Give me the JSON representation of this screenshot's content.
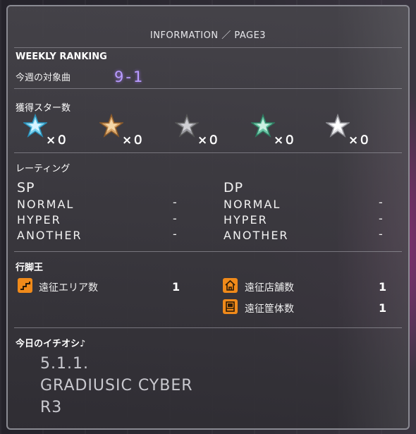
{
  "header": {
    "title": "INFORMATION ／ PAGE3"
  },
  "weekly": {
    "heading": "WEEKLY RANKING",
    "target_label": "今週の対象曲",
    "target_song": "9-1"
  },
  "stars": {
    "heading": "獲得スター数",
    "items": [
      {
        "color": "blue-star",
        "count": "×０"
      },
      {
        "color": "gold-star",
        "count": "×０"
      },
      {
        "color": "silver-star",
        "count": "×０"
      },
      {
        "color": "green-star",
        "count": "×０"
      },
      {
        "color": "white-star",
        "count": "×０"
      }
    ]
  },
  "rating": {
    "heading": "レーティング",
    "sp": {
      "label": "SP",
      "normal": "NORMAL",
      "hyper": "HYPER",
      "another": "ANOTHER",
      "normal_value": "-",
      "hyper_value": "-",
      "another_value": "-"
    },
    "dp": {
      "label": "DP",
      "normal": "NORMAL",
      "hyper": "HYPER",
      "another": "ANOTHER",
      "normal_value": "-",
      "hyper_value": "-",
      "another_value": "-"
    }
  },
  "expedition": {
    "heading": "行脚王",
    "area_label": "遠征エリア数",
    "area_value": "1",
    "store_label": "遠征店舗数",
    "store_value": "1",
    "cabinet_label": "遠征筐体数",
    "cabinet_value": "1"
  },
  "pick": {
    "heading": "今日のイチオシ♪",
    "line1": "5.1.1.",
    "line2": "GRADIUSIC CYBER",
    "line3": "R3"
  },
  "colors": {
    "accent_song": "#b89cff",
    "icon_orange": "#f08a1a"
  }
}
